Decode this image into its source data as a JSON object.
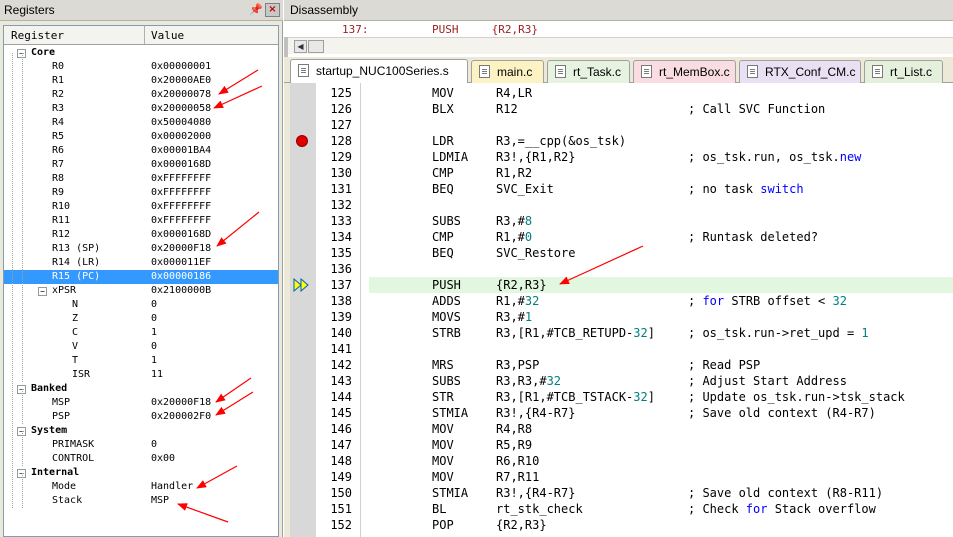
{
  "registers_panel": {
    "title": "Registers",
    "pin_icon": "pin-icon",
    "close_icon": "close-icon",
    "columns": [
      "Register",
      "Value"
    ],
    "groups": [
      {
        "name": "Core",
        "toggle": "−",
        "rows": [
          {
            "name": "R0",
            "value": "0x00000001"
          },
          {
            "name": "R1",
            "value": "0x20000AE0"
          },
          {
            "name": "R2",
            "value": "0x20000078"
          },
          {
            "name": "R3",
            "value": "0x20000058"
          },
          {
            "name": "R4",
            "value": "0x50004080"
          },
          {
            "name": "R5",
            "value": "0x00002000"
          },
          {
            "name": "R6",
            "value": "0x00001BA4"
          },
          {
            "name": "R7",
            "value": "0x0000168D"
          },
          {
            "name": "R8",
            "value": "0xFFFFFFFF"
          },
          {
            "name": "R9",
            "value": "0xFFFFFFFF"
          },
          {
            "name": "R10",
            "value": "0xFFFFFFFF"
          },
          {
            "name": "R11",
            "value": "0xFFFFFFFF"
          },
          {
            "name": "R12",
            "value": "0x0000168D"
          },
          {
            "name": "R13 (SP)",
            "value": "0x20000F18"
          },
          {
            "name": "R14 (LR)",
            "value": "0x000011EF"
          },
          {
            "name": "R15 (PC)",
            "value": "0x00000186",
            "selected": true
          }
        ],
        "xpsr": {
          "name": "xPSR",
          "value": "0x2100000B",
          "toggle": "−",
          "flags": [
            {
              "name": "N",
              "value": "0"
            },
            {
              "name": "Z",
              "value": "0"
            },
            {
              "name": "C",
              "value": "1"
            },
            {
              "name": "V",
              "value": "0"
            },
            {
              "name": "T",
              "value": "1"
            },
            {
              "name": "ISR",
              "value": "11"
            }
          ]
        }
      },
      {
        "name": "Banked",
        "toggle": "−",
        "rows": [
          {
            "name": "MSP",
            "value": "0x20000F18"
          },
          {
            "name": "PSP",
            "value": "0x200002F0"
          }
        ]
      },
      {
        "name": "System",
        "toggle": "−",
        "rows": [
          {
            "name": "PRIMASK",
            "value": "0"
          },
          {
            "name": "CONTROL",
            "value": "0x00"
          }
        ]
      },
      {
        "name": "Internal",
        "toggle": "−",
        "rows": [
          {
            "name": "Mode",
            "value": "Handler"
          },
          {
            "name": "Stack",
            "value": "MSP"
          }
        ]
      }
    ]
  },
  "disassembly": {
    "title": "Disassembly",
    "address": "137:",
    "instruction": "PUSH     {R2,R3}",
    "scroll_left_icon": "scroll-left-icon"
  },
  "tabs": [
    {
      "label": "startup_NUC100Series.s",
      "color": "#ffffff",
      "active": true
    },
    {
      "label": "main.c",
      "color": "#fdf2c4"
    },
    {
      "label": "rt_Task.c",
      "color": "#e6f3e0"
    },
    {
      "label": "rt_MemBox.c",
      "color": "#f9dde2"
    },
    {
      "label": "RTX_Conf_CM.c",
      "color": "#e9e0f3"
    },
    {
      "label": "rt_List.c",
      "color": "#e4f0dc"
    }
  ],
  "code": {
    "current_line": "137",
    "breakpoint_line": "128",
    "lines": [
      {
        "n": "125",
        "mn": "MOV",
        "op": "R4,LR",
        "cm": ""
      },
      {
        "n": "126",
        "mn": "BLX",
        "op": "R12",
        "cm": "; Call SVC Function"
      },
      {
        "n": "127",
        "mn": "",
        "op": "",
        "cm": ""
      },
      {
        "n": "128",
        "mn": "LDR",
        "op": "R3,=__cpp(&os_tsk)",
        "cm": ""
      },
      {
        "n": "129",
        "mn": "LDMIA",
        "op": "R3!,{R1,R2}",
        "cm": "; os_tsk.run, os_tsk.new"
      },
      {
        "n": "130",
        "mn": "CMP",
        "op": "R1,R2",
        "cm": ""
      },
      {
        "n": "131",
        "mn": "BEQ",
        "op": "SVC_Exit",
        "cm": "; no task switch"
      },
      {
        "n": "132",
        "mn": "",
        "op": "",
        "cm": ""
      },
      {
        "n": "133",
        "mn": "SUBS",
        "op": "R3,#8",
        "cm": ""
      },
      {
        "n": "134",
        "mn": "CMP",
        "op": "R1,#0",
        "cm": "; Runtask deleted?"
      },
      {
        "n": "135",
        "mn": "BEQ",
        "op": "SVC_Restore",
        "cm": ""
      },
      {
        "n": "136",
        "mn": "",
        "op": "",
        "cm": ""
      },
      {
        "n": "137",
        "mn": "PUSH",
        "op": "{R2,R3}",
        "cm": ""
      },
      {
        "n": "138",
        "mn": "ADDS",
        "op": "R1,#32",
        "cm": "; for STRB offset < 32"
      },
      {
        "n": "139",
        "mn": "MOVS",
        "op": "R3,#1",
        "cm": ""
      },
      {
        "n": "140",
        "mn": "STRB",
        "op": "R3,[R1,#TCB_RETUPD-32]",
        "cm": "; os_tsk.run->ret_upd = 1"
      },
      {
        "n": "141",
        "mn": "",
        "op": "",
        "cm": ""
      },
      {
        "n": "142",
        "mn": "MRS",
        "op": "R3,PSP",
        "cm": "; Read PSP"
      },
      {
        "n": "143",
        "mn": "SUBS",
        "op": "R3,R3,#32",
        "cm": "; Adjust Start Address"
      },
      {
        "n": "144",
        "mn": "STR",
        "op": "R3,[R1,#TCB_TSTACK-32]",
        "cm": "; Update os_tsk.run->tsk_stack"
      },
      {
        "n": "145",
        "mn": "STMIA",
        "op": "R3!,{R4-R7}",
        "cm": "; Save old context (R4-R7)"
      },
      {
        "n": "146",
        "mn": "MOV",
        "op": "R4,R8",
        "cm": ""
      },
      {
        "n": "147",
        "mn": "MOV",
        "op": "R5,R9",
        "cm": ""
      },
      {
        "n": "148",
        "mn": "MOV",
        "op": "R6,R10",
        "cm": ""
      },
      {
        "n": "149",
        "mn": "MOV",
        "op": "R7,R11",
        "cm": ""
      },
      {
        "n": "150",
        "mn": "STMIA",
        "op": "R3!,{R4-R7}",
        "cm": "; Save old context (R8-R11)"
      },
      {
        "n": "151",
        "mn": "BL",
        "op": "rt_stk_check",
        "cm": "; Check for Stack overflow"
      },
      {
        "n": "152",
        "mn": "POP",
        "op": "{R2,R3}",
        "cm": ""
      }
    ]
  },
  "colors": {
    "selection": "#3399ff",
    "breakpoint": "#e00000",
    "current_line_bg": "#e2f7e0",
    "annotation_arrow": "#ff0000",
    "keyword": "#0000ff",
    "number": "#008080"
  }
}
